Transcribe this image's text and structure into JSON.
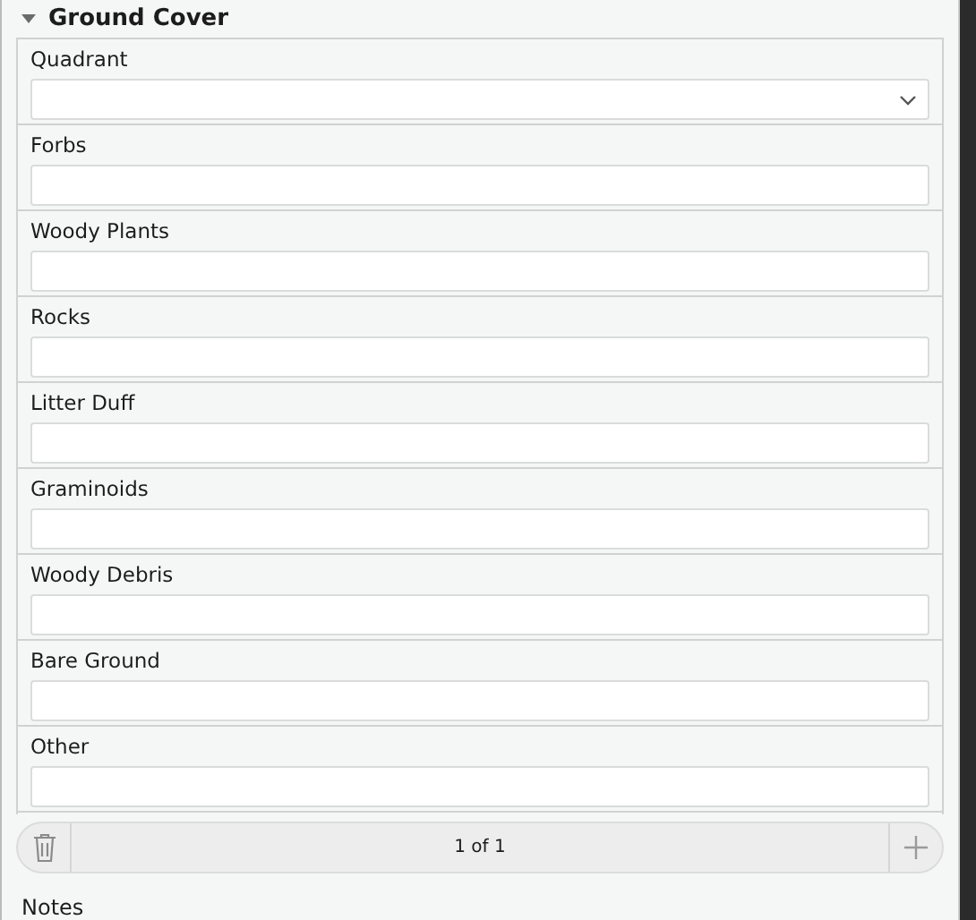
{
  "section": {
    "title": "Ground Cover",
    "expanded": true
  },
  "fields": [
    {
      "label": "Quadrant",
      "kind": "dropdown"
    },
    {
      "label": "Forbs",
      "kind": "text"
    },
    {
      "label": "Woody Plants",
      "kind": "text"
    },
    {
      "label": "Rocks",
      "kind": "text"
    },
    {
      "label": "Litter Duff",
      "kind": "text"
    },
    {
      "label": "Graminoids",
      "kind": "text"
    },
    {
      "label": "Woody Debris",
      "kind": "text"
    },
    {
      "label": "Bare Ground",
      "kind": "text"
    },
    {
      "label": "Other",
      "kind": "text"
    }
  ],
  "pager": {
    "text": "1 of 1"
  },
  "next_label": "Notes"
}
